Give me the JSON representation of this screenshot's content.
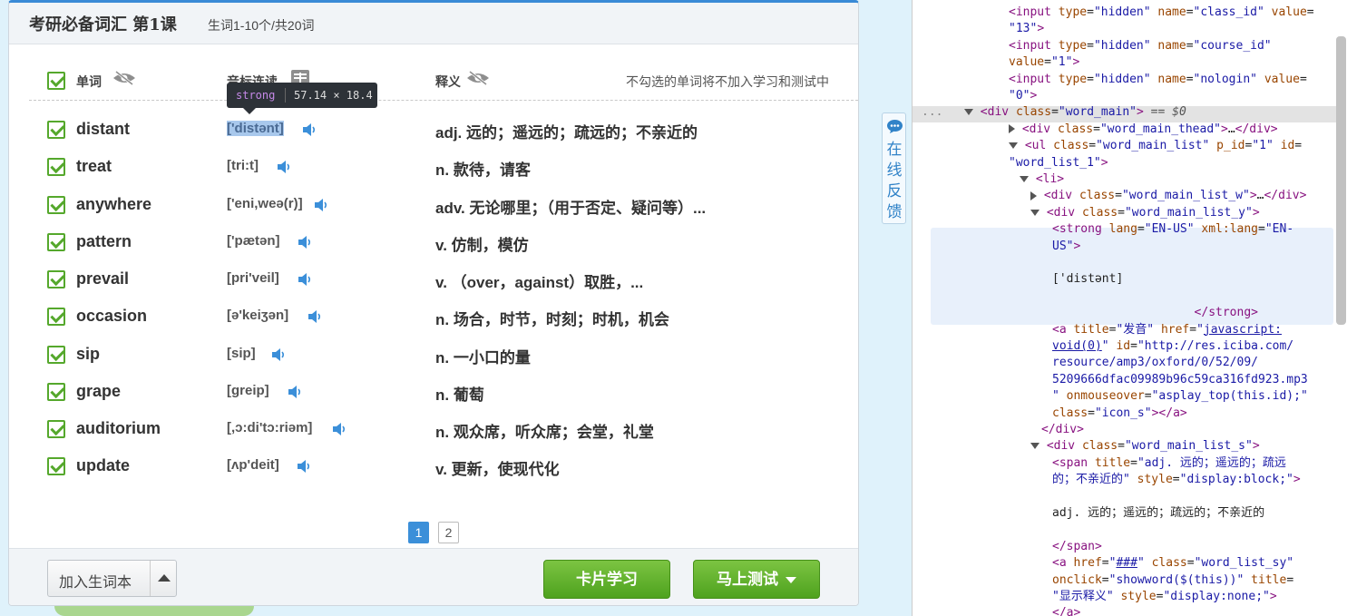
{
  "header": {
    "title": "考研必备词汇 第1课",
    "subtitle": "生词1-10个/共20词"
  },
  "table_head": {
    "col_word": "单词",
    "col_phonetic": "音标连读",
    "col_meaning": "释义",
    "hint": "不勾选的单词将不加入学习和测试中"
  },
  "tooltip": {
    "tag": "strong",
    "size": "57.14 × 18.4"
  },
  "words": [
    {
      "word": "distant",
      "phonetic": "['distənt]",
      "meaning": "adj. 远的；遥远的；疏远的；不亲近的"
    },
    {
      "word": "treat",
      "phonetic": "[tri:t]",
      "meaning": "n. 款待，请客"
    },
    {
      "word": "anywhere",
      "phonetic": "['eni,weə(r)]",
      "meaning": "adv. 无论哪里；（用于否定、疑问等）..."
    },
    {
      "word": "pattern",
      "phonetic": "['pætən]",
      "meaning": "v. 仿制，模仿"
    },
    {
      "word": "prevail",
      "phonetic": "[pri'veil]",
      "meaning": "v. （over，against）取胜，..."
    },
    {
      "word": "occasion",
      "phonetic": "[ə'keiʒən]",
      "meaning": "n. 场合，时节，时刻；时机，机会"
    },
    {
      "word": "sip",
      "phonetic": "[sip]",
      "meaning": "n. 一小口的量"
    },
    {
      "word": "grape",
      "phonetic": "[greip]",
      "meaning": "n. 葡萄"
    },
    {
      "word": "auditorium",
      "phonetic": "[,ɔ:di'tɔ:riəm]",
      "meaning": "n. 观众席，听众席；会堂，礼堂"
    },
    {
      "word": "update",
      "phonetic": "[ʌp'deit]",
      "meaning": "v. 更新，使现代化"
    }
  ],
  "pager": {
    "current": "1",
    "next": "2"
  },
  "footer": {
    "add_label": "加入生词本",
    "card_label": "卡片学习",
    "test_label": "马上测试"
  },
  "feedback": {
    "label": "在线反馈"
  },
  "colors": {
    "accent_green": "#55a82c",
    "accent_blue": "#3b8fd9",
    "devtools_tag": "#881280"
  },
  "devtools": {
    "lines": [
      {
        "indent": 8,
        "html": "<span class='tg'>&lt;input</span> <span class='an'>type</span>=<span class='av'>\"hidden\"</span> <span class='an'>name</span>=<span class='av'>\"class_id\"</span> <span class='an'>value</span>="
      },
      {
        "indent": 8,
        "html": "<span class='av'>\"13\"</span><span class='tg'>&gt;</span>"
      },
      {
        "indent": 8,
        "html": "<span class='tg'>&lt;input</span> <span class='an'>type</span>=<span class='av'>\"hidden\"</span> <span class='an'>name</span>=<span class='av'>\"course_id\"</span>"
      },
      {
        "indent": 8,
        "html": "<span class='an'>value</span>=<span class='av'>\"1\"</span><span class='tg'>&gt;</span>"
      },
      {
        "indent": 8,
        "html": "<span class='tg'>&lt;input</span> <span class='an'>type</span>=<span class='av'>\"hidden\"</span> <span class='an'>name</span>=<span class='av'>\"nologin\"</span> <span class='an'>value</span>="
      },
      {
        "indent": 8,
        "html": "<span class='av'>\"0\"</span><span class='tg'>&gt;</span>"
      },
      {
        "indent": 0,
        "html": "<span style='color:#888'>...</span>   <i class='tri d'></i> <span class='tg'>&lt;div</span> <span class='an'>class</span>=<span class='av'>\"word_main\"</span><span class='tg'>&gt;</span> <span style='color:#555'>== </span><i style='color:#555'>$0</i>"
      },
      {
        "indent": 8,
        "html": "<i class='tri r'></i> <span class='tg'>&lt;div</span> <span class='an'>class</span>=<span class='av'>\"word_main_thead\"</span><span class='tg'>&gt;</span>…<span class='tg'>&lt;/div&gt;</span>"
      },
      {
        "indent": 8,
        "html": "<i class='tri d'></i> <span class='tg'>&lt;ul</span> <span class='an'>class</span>=<span class='av'>\"word_main_list\"</span> <span class='an'>p_id</span>=<span class='av'>\"1\"</span> <span class='an'>id</span>="
      },
      {
        "indent": 8,
        "html": "<span class='av'>\"word_list_1\"</span><span class='tg'>&gt;</span>"
      },
      {
        "indent": 9,
        "html": "<i class='tri d'></i> <span class='tg'>&lt;li&gt;</span>"
      },
      {
        "indent": 10,
        "html": "<i class='tri r'></i> <span class='tg'>&lt;div</span> <span class='an'>class</span>=<span class='av'>\"word_main_list_w\"</span><span class='tg'>&gt;</span>…<span class='tg'>&lt;/div&gt;</span>"
      },
      {
        "indent": 10,
        "html": "<i class='tri d'></i> <span class='tg'>&lt;div</span> <span class='an'>class</span>=<span class='av'>\"word_main_list_y\"</span><span class='tg'>&gt;</span>"
      },
      {
        "indent": 12,
        "html": "<span class='tg'>&lt;strong</span> <span class='an'>lang</span>=<span class='av'>\"EN-US\"</span> <span class='an'>xml:lang</span>=<span class='av'>\"EN-</span>"
      },
      {
        "indent": 12,
        "html": "<span class='av'>US\"</span><span class='tg'>&gt;</span>"
      },
      {
        "indent": 12,
        "html": ""
      },
      {
        "indent": 12,
        "html": "['distənt]"
      },
      {
        "indent": 12,
        "html": ""
      },
      {
        "indent": 12,
        "html": "                    <span class='tg'>&lt;/strong&gt;</span>"
      },
      {
        "indent": 12,
        "html": "<span class='tg'>&lt;a</span> <span class='an'>title</span>=<span class='av'>\"发音\"</span> <span class='an'>href</span>=<span class='av'>\"</span><span class='lk'>javascript:</span>"
      },
      {
        "indent": 12,
        "html": "<span class='lk'>void(0)</span><span class='av'>\"</span> <span class='an'>id</span>=<span class='av'>\"http://res.iciba.com/</span>"
      },
      {
        "indent": 12,
        "html": "<span class='av'>resource/amp3/oxford/0/52/09/</span>"
      },
      {
        "indent": 12,
        "html": "<span class='av'>5209666dfac09989b96c59ca316fd923.mp3</span>"
      },
      {
        "indent": 12,
        "html": "<span class='av'>\"</span> <span class='an'>onmouseover</span>=<span class='av'>\"asplay_top(this.id);\"</span>"
      },
      {
        "indent": 12,
        "html": "<span class='an'>class</span>=<span class='av'>\"icon_s\"</span><span class='tg'>&gt;&lt;/a&gt;</span>"
      },
      {
        "indent": 11,
        "html": "<span class='tg'>&lt;/div&gt;</span>"
      },
      {
        "indent": 10,
        "html": "<i class='tri d'></i> <span class='tg'>&lt;div</span> <span class='an'>class</span>=<span class='av'>\"word_main_list_s\"</span><span class='tg'>&gt;</span>"
      },
      {
        "indent": 12,
        "html": "<span class='tg'>&lt;span</span> <span class='an'>title</span>=<span class='av'>\"adj. 远的；遥远的；疏远</span>"
      },
      {
        "indent": 12,
        "html": "<span class='av'>的；不亲近的\"</span> <span class='an'>style</span>=<span class='av'>\"display:block;\"</span><span class='tg'>&gt;</span>"
      },
      {
        "indent": 12,
        "html": ""
      },
      {
        "indent": 12,
        "html": "adj. 远的；遥远的；疏远的；不亲近的"
      },
      {
        "indent": 12,
        "html": ""
      },
      {
        "indent": 12,
        "html": "<span class='tg'>&lt;/span&gt;</span>"
      },
      {
        "indent": 12,
        "html": "<span class='tg'>&lt;a</span> <span class='an'>href</span>=<span class='av'>\"</span><span class='lk'>###</span><span class='av'>\"</span> <span class='an'>class</span>=<span class='av'>\"word_list_sy\"</span>"
      },
      {
        "indent": 12,
        "html": "<span class='an'>onclick</span>=<span class='av'>\"showword($(this))\"</span> <span class='an'>title</span>="
      },
      {
        "indent": 12,
        "html": "<span class='av'>\"显示释义\"</span> <span class='an'>style</span>=<span class='av'>\"display:none;\"</span><span class='tg'>&gt;</span>"
      },
      {
        "indent": 12,
        "html": "<span class='tg'>&lt;/a&gt;</span>"
      }
    ]
  }
}
